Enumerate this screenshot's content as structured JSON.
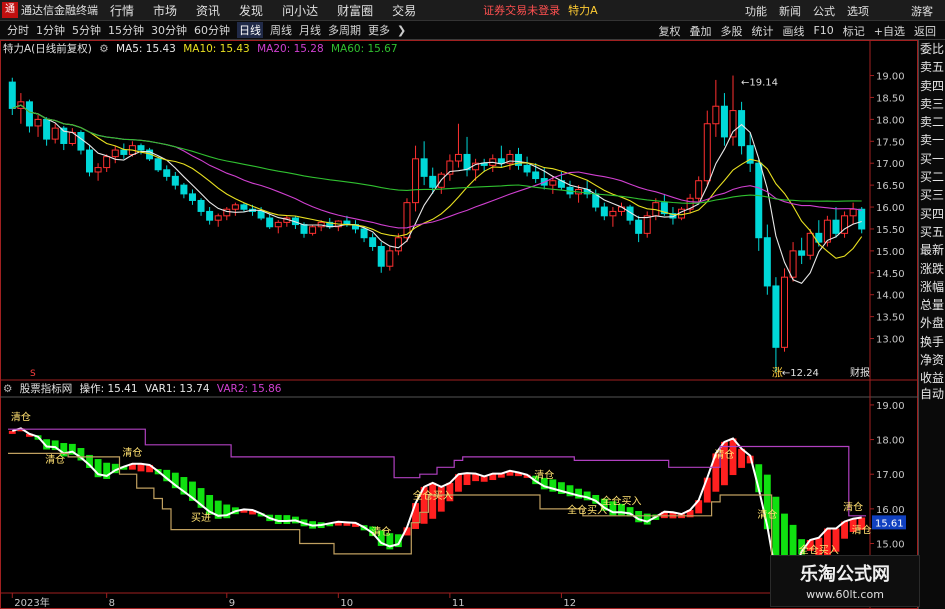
{
  "app": {
    "logo": "通",
    "title": "通达信金融终端"
  },
  "menu": [
    "行情",
    "市场",
    "资讯",
    "发现",
    "问小达",
    "财富圈",
    "交易"
  ],
  "notice": "证券交易未登录",
  "stock_name": "特力A",
  "menubar_right": [
    "功能",
    "新闻",
    "公式",
    "选项"
  ],
  "guest": "游客",
  "periods": [
    "分时",
    "1分钟",
    "5分钟",
    "15分钟",
    "30分钟",
    "60分钟",
    "日线",
    "周线",
    "月线",
    "多周期",
    "更多"
  ],
  "active_period": "日线",
  "toolbar_right": [
    "复权",
    "叠加",
    "多股",
    "统计",
    "画线",
    "F10",
    "标记",
    "+自选",
    "返回"
  ],
  "main_legend": {
    "title": "特力A(日线前复权)",
    "items": [
      {
        "label": "MA5: 15.43",
        "color": "#e8e8e8"
      },
      {
        "label": "MA10: 15.43",
        "color": "#e8e020"
      },
      {
        "label": "MA20: 15.28",
        "color": "#d040d0"
      },
      {
        "label": "MA60: 15.67",
        "color": "#30c030"
      }
    ]
  },
  "sub_legend": {
    "title": "股票指标网",
    "items": [
      {
        "label": "操作: 15.41",
        "color": "#e8e8e8"
      },
      {
        "label": "VAR1: 13.74",
        "color": "#e8e8e8"
      },
      {
        "label": "VAR2: 15.86",
        "color": "#d040d0"
      }
    ]
  },
  "main_axis_labels": [
    "19.00",
    "18.50",
    "18.00",
    "17.50",
    "17.00",
    "16.50",
    "16.00",
    "15.50",
    "15.00",
    "14.50",
    "14.00",
    "13.50",
    "13.00"
  ],
  "sub_axis_labels": [
    "19.00",
    "18.00",
    "17.00",
    "16.00",
    "15.00",
    "14.00"
  ],
  "sub_current_value": "15.61",
  "high_label": "19.14",
  "low_label": "12.24",
  "zhang_label": "涨",
  "report_label": "财报",
  "marker_label": "S",
  "x_axis_labels": [
    "2023年",
    "8",
    "9",
    "10",
    "11",
    "12",
    "2"
  ],
  "signal_labels": [
    "清仓",
    "清仓",
    "清仓",
    "买进",
    "清仓",
    "全仓买入",
    "清仓",
    "全仓买入",
    "全仓买入",
    "清仓",
    "清仓",
    "全仓买入",
    "清仓",
    "清仓"
  ],
  "side_panel": [
    "委比",
    "卖五",
    "卖四",
    "卖三",
    "卖二",
    "卖一",
    "买一",
    "买二",
    "买三",
    "买四",
    "买五",
    "最新",
    "涨跌",
    "涨幅",
    "总量",
    "外盘",
    "换手",
    "净资",
    "收益"
  ],
  "side_auto": "自动",
  "watermark": {
    "title": "乐淘公式网",
    "url": "www.60lt.com"
  },
  "colors": {
    "up": "#ff3030",
    "down": "#00d8d8",
    "ma5": "#e8e8e8",
    "ma10": "#e8e020",
    "ma20": "#d040d0",
    "ma60": "#30c030",
    "axis": "#a02020"
  },
  "chart_data": {
    "type": "candlestick",
    "price_range": [
      12.24,
      19.14
    ],
    "x_labels": [
      "2023年",
      "8",
      "9",
      "10",
      "11",
      "12",
      "2"
    ],
    "ohlc": [
      [
        18.85,
        18.95,
        18.1,
        18.25
      ],
      [
        18.25,
        18.6,
        17.9,
        18.4
      ],
      [
        18.4,
        18.45,
        17.7,
        17.85
      ],
      [
        17.85,
        18.1,
        17.6,
        18.0
      ],
      [
        18.0,
        18.05,
        17.4,
        17.55
      ],
      [
        17.55,
        17.9,
        17.45,
        17.8
      ],
      [
        17.8,
        17.85,
        17.3,
        17.45
      ],
      [
        17.45,
        17.8,
        17.4,
        17.7
      ],
      [
        17.7,
        17.75,
        17.2,
        17.3
      ],
      [
        17.3,
        17.4,
        16.7,
        16.8
      ],
      [
        16.8,
        17.0,
        16.6,
        16.9
      ],
      [
        16.9,
        17.2,
        16.8,
        17.15
      ],
      [
        17.15,
        17.4,
        17.0,
        17.3
      ],
      [
        17.3,
        17.45,
        17.1,
        17.2
      ],
      [
        17.2,
        17.5,
        17.15,
        17.4
      ],
      [
        17.4,
        17.45,
        17.2,
        17.3
      ],
      [
        17.3,
        17.35,
        17.05,
        17.1
      ],
      [
        17.1,
        17.15,
        16.8,
        16.85
      ],
      [
        16.85,
        16.95,
        16.6,
        16.7
      ],
      [
        16.7,
        16.8,
        16.4,
        16.5
      ],
      [
        16.5,
        16.55,
        16.2,
        16.3
      ],
      [
        16.3,
        16.4,
        16.05,
        16.15
      ],
      [
        16.15,
        16.2,
        15.8,
        15.9
      ],
      [
        15.9,
        16.0,
        15.6,
        15.7
      ],
      [
        15.7,
        15.85,
        15.55,
        15.8
      ],
      [
        15.8,
        16.0,
        15.7,
        15.95
      ],
      [
        15.95,
        16.1,
        15.8,
        16.05
      ],
      [
        16.05,
        16.1,
        15.9,
        15.95
      ],
      [
        15.95,
        16.05,
        15.8,
        15.9
      ],
      [
        15.9,
        16.0,
        15.7,
        15.75
      ],
      [
        15.75,
        15.85,
        15.5,
        15.55
      ],
      [
        15.55,
        15.7,
        15.4,
        15.65
      ],
      [
        15.65,
        15.8,
        15.55,
        15.75
      ],
      [
        15.75,
        15.8,
        15.5,
        15.6
      ],
      [
        15.6,
        15.65,
        15.3,
        15.4
      ],
      [
        15.4,
        15.6,
        15.35,
        15.55
      ],
      [
        15.55,
        15.7,
        15.45,
        15.65
      ],
      [
        15.65,
        15.75,
        15.5,
        15.55
      ],
      [
        15.55,
        15.7,
        15.45,
        15.68
      ],
      [
        15.68,
        15.8,
        15.55,
        15.6
      ],
      [
        15.6,
        15.7,
        15.4,
        15.5
      ],
      [
        15.5,
        15.55,
        15.2,
        15.3
      ],
      [
        15.3,
        15.4,
        15.0,
        15.1
      ],
      [
        15.1,
        15.2,
        14.5,
        14.65
      ],
      [
        14.65,
        15.1,
        14.55,
        15.0
      ],
      [
        15.0,
        15.4,
        14.9,
        15.3
      ],
      [
        15.3,
        16.2,
        15.2,
        16.1
      ],
      [
        16.1,
        17.4,
        15.9,
        17.1
      ],
      [
        17.1,
        17.5,
        16.5,
        16.7
      ],
      [
        16.7,
        16.9,
        16.3,
        16.45
      ],
      [
        16.45,
        16.8,
        16.3,
        16.75
      ],
      [
        16.75,
        17.2,
        16.6,
        17.05
      ],
      [
        17.05,
        17.9,
        16.9,
        17.2
      ],
      [
        17.2,
        17.6,
        16.7,
        16.85
      ],
      [
        16.85,
        17.1,
        16.6,
        17.0
      ],
      [
        17.0,
        17.1,
        16.8,
        16.95
      ],
      [
        16.95,
        17.2,
        16.8,
        17.1
      ],
      [
        17.1,
        17.4,
        16.9,
        17.0
      ],
      [
        17.0,
        17.3,
        16.85,
        17.2
      ],
      [
        17.2,
        17.35,
        16.85,
        16.95
      ],
      [
        16.95,
        17.15,
        16.7,
        16.8
      ],
      [
        16.8,
        17.0,
        16.55,
        16.65
      ],
      [
        16.65,
        16.9,
        16.4,
        16.5
      ],
      [
        16.5,
        16.7,
        16.3,
        16.6
      ],
      [
        16.6,
        16.8,
        16.4,
        16.45
      ],
      [
        16.45,
        16.6,
        16.2,
        16.3
      ],
      [
        16.3,
        16.5,
        16.1,
        16.4
      ],
      [
        16.4,
        16.6,
        16.2,
        16.3
      ],
      [
        16.3,
        16.4,
        15.9,
        16.0
      ],
      [
        16.0,
        16.1,
        15.7,
        15.8
      ],
      [
        15.8,
        16.0,
        15.55,
        15.9
      ],
      [
        15.9,
        16.1,
        15.8,
        16.0
      ],
      [
        16.0,
        16.05,
        15.6,
        15.7
      ],
      [
        15.7,
        15.8,
        15.2,
        15.4
      ],
      [
        15.4,
        15.9,
        15.3,
        15.8
      ],
      [
        15.8,
        16.2,
        15.7,
        16.1
      ],
      [
        16.1,
        16.3,
        15.8,
        15.85
      ],
      [
        15.85,
        16.0,
        15.6,
        15.75
      ],
      [
        15.75,
        16.0,
        15.7,
        15.95
      ],
      [
        15.95,
        16.3,
        15.85,
        16.2
      ],
      [
        16.2,
        16.7,
        16.1,
        16.6
      ],
      [
        16.6,
        18.2,
        16.5,
        17.9
      ],
      [
        17.9,
        18.9,
        17.6,
        18.3
      ],
      [
        18.3,
        18.6,
        17.4,
        17.6
      ],
      [
        17.6,
        19.0,
        17.4,
        18.2
      ],
      [
        18.2,
        18.4,
        17.2,
        17.4
      ],
      [
        17.4,
        17.7,
        16.8,
        17.0
      ],
      [
        17.0,
        17.1,
        15.0,
        15.3
      ],
      [
        15.3,
        15.6,
        14.0,
        14.2
      ],
      [
        14.2,
        14.4,
        12.24,
        12.8
      ],
      [
        12.8,
        14.6,
        12.7,
        14.4
      ],
      [
        14.4,
        15.2,
        14.3,
        15.0
      ],
      [
        15.0,
        15.3,
        14.7,
        14.9
      ],
      [
        14.9,
        15.5,
        14.8,
        15.4
      ],
      [
        15.4,
        15.7,
        15.1,
        15.2
      ],
      [
        15.2,
        15.8,
        15.1,
        15.7
      ],
      [
        15.7,
        16.0,
        15.3,
        15.4
      ],
      [
        15.4,
        15.9,
        15.3,
        15.8
      ],
      [
        15.8,
        16.1,
        15.6,
        15.95
      ],
      [
        15.95,
        16.0,
        15.4,
        15.5
      ]
    ],
    "sub_range": [
      13.6,
      19.2
    ],
    "var2": [
      18.3,
      18.3,
      18.3,
      18.3,
      18.3,
      18.3,
      18.3,
      18.3,
      18.3,
      18.3,
      18.3,
      18.3,
      18.3,
      18.3,
      18.3,
      18.3,
      17.85,
      17.85,
      17.85,
      17.85,
      17.85,
      17.85,
      17.85,
      17.85,
      17.85,
      17.85,
      17.5,
      17.5,
      17.5,
      17.5,
      17.5,
      17.5,
      17.5,
      17.5,
      17.5,
      17.5,
      17.5,
      17.5,
      17.5,
      17.5,
      17.5,
      17.5,
      17.5,
      17.5,
      17.5,
      16.9,
      16.9,
      16.9,
      17.0,
      17.0,
      17.2,
      17.2,
      17.4,
      17.5,
      17.5,
      17.5,
      17.5,
      17.5,
      17.5,
      17.5,
      17.5,
      17.5,
      17.5,
      17.5,
      17.5,
      17.5,
      17.4,
      17.4,
      17.4,
      17.4,
      17.4,
      17.4,
      17.4,
      17.4,
      17.4,
      17.4,
      17.4,
      17.2,
      17.2,
      17.2,
      17.2,
      17.2,
      17.2,
      17.8,
      17.8,
      17.8,
      17.8,
      17.8,
      17.8,
      17.8,
      17.8,
      17.8,
      17.8,
      17.8,
      17.8,
      17.8,
      17.8,
      17.8,
      15.8,
      15.8
    ],
    "var1": [
      17.6,
      17.6,
      17.6,
      17.6,
      17.6,
      17.6,
      17.6,
      17.5,
      17.5,
      17.5,
      17.5,
      17.5,
      17.5,
      17.0,
      17.0,
      16.6,
      16.6,
      16.3,
      16.0,
      15.4,
      15.4,
      15.4,
      15.4,
      15.4,
      15.4,
      15.4,
      15.4,
      15.4,
      15.4,
      15.4,
      15.4,
      15.4,
      15.4,
      15.4,
      15.0,
      15.0,
      15.0,
      15.0,
      14.7,
      14.7,
      14.7,
      14.7,
      14.7,
      14.7,
      14.7,
      14.7,
      14.7,
      15.6,
      15.9,
      16.4,
      16.4,
      16.4,
      16.4,
      16.4,
      16.4,
      16.4,
      16.4,
      16.4,
      16.4,
      16.4,
      16.4,
      16.4,
      16.0,
      16.0,
      16.0,
      16.0,
      16.0,
      15.8,
      15.8,
      15.8,
      15.8,
      15.8,
      15.8,
      15.8,
      15.8,
      15.8,
      15.8,
      15.8,
      15.8,
      15.8,
      15.8,
      15.8,
      16.2,
      16.4,
      16.4,
      16.4,
      16.4,
      16.4,
      16.4,
      14.3,
      14.3,
      14.3,
      14.3,
      14.3,
      14.3,
      14.3,
      14.3,
      14.3,
      14.3,
      14.3,
      14.3
    ],
    "signals": [
      {
        "i": 1,
        "text": "清仓"
      },
      {
        "i": 5,
        "text": "清仓"
      },
      {
        "i": 14,
        "text": "清仓"
      },
      {
        "i": 22,
        "text": "买进"
      },
      {
        "i": 43,
        "text": "清仓"
      },
      {
        "i": 49,
        "text": "全仓买入"
      },
      {
        "i": 62,
        "text": "清仓"
      },
      {
        "i": 67,
        "text": "全仓买入"
      },
      {
        "i": 71,
        "text": "全仓买入"
      },
      {
        "i": 83,
        "text": "清仓"
      },
      {
        "i": 88,
        "text": "清仓"
      },
      {
        "i": 94,
        "text": "全仓买入"
      },
      {
        "i": 98,
        "text": "清仓"
      },
      {
        "i": 99,
        "text": "清仓"
      }
    ]
  }
}
